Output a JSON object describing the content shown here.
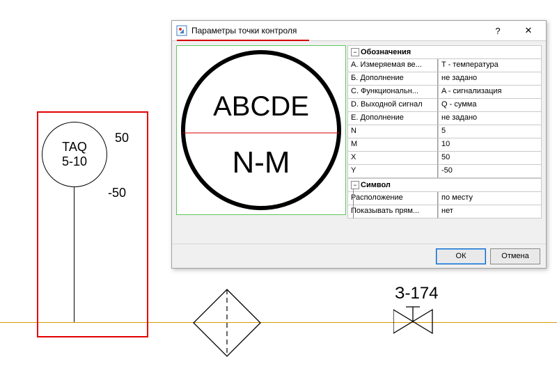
{
  "dialog": {
    "title": "Параметры точки контроля",
    "help_glyph": "?",
    "close_glyph": "✕",
    "ok": "ОК",
    "cancel": "Отмена",
    "preview": {
      "top": "ABCDE",
      "bottom": "N-M"
    },
    "sections": {
      "oboz": {
        "label": "Обозначения",
        "toggle": "−"
      },
      "sym": {
        "label": "Символ",
        "toggle": "−"
      }
    },
    "props": [
      {
        "k": "A. Измеряемая ве...",
        "v": "T - температура"
      },
      {
        "k": "Б. Дополнение",
        "v": "не задано"
      },
      {
        "k": "C. Функциональн...",
        "v": "A - сигнализация"
      },
      {
        "k": "D. Выходной сигнал",
        "v": "Q - сумма"
      },
      {
        "k": "E. Дополнение",
        "v": "не задано"
      },
      {
        "k": "N",
        "v": "5"
      },
      {
        "k": "M",
        "v": "10"
      },
      {
        "k": "X",
        "v": "50"
      },
      {
        "k": "Y",
        "v": "-50"
      }
    ],
    "sym_props": [
      {
        "k": "Расположение",
        "v": "по месту"
      },
      {
        "k": "Показывать прям...",
        "v": "нет"
      }
    ]
  },
  "drawing": {
    "tag_line1": "TAQ",
    "tag_line2": "5-10",
    "lim_hi": "50",
    "lim_lo": "-50",
    "valve_label": "З-174"
  }
}
